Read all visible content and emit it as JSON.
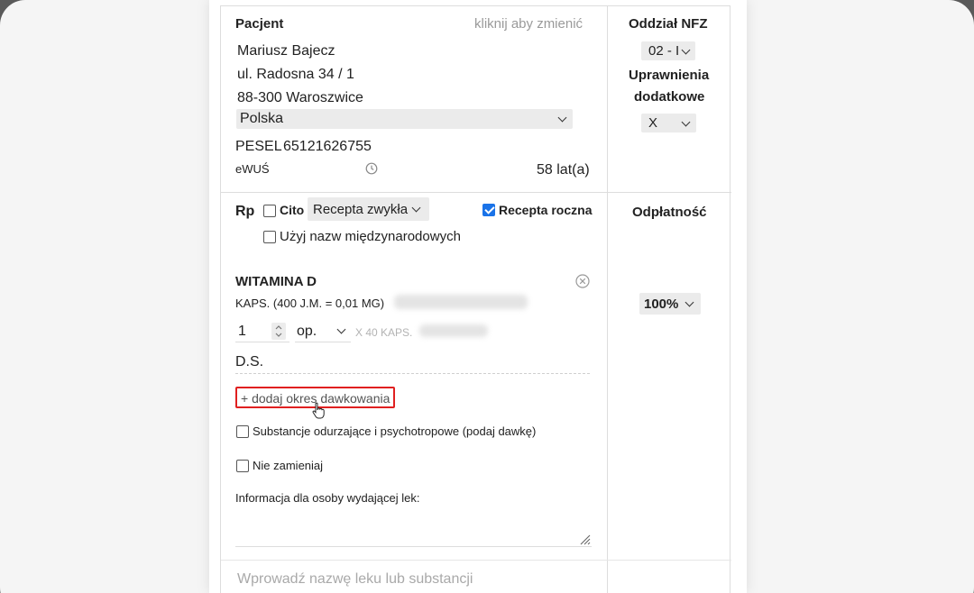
{
  "patient": {
    "heading": "Pacjent",
    "change_hint": "kliknij aby zmienić",
    "name": "Mariusz Bajecz",
    "street": "ul. Radosna 34 / 1",
    "city": "88-300 Waroszwice",
    "country": "Polska",
    "pesel_label": "PESEL",
    "pesel": "65121626755",
    "ewus_label": "eWUŚ",
    "age": "58",
    "age_unit": "lat(a)"
  },
  "nfz": {
    "heading": "Oddział NFZ",
    "branch_value": "02 - I",
    "permissions_label_1": "Uprawnienia",
    "permissions_label_2": "dodatkowe",
    "permissions_value": "X"
  },
  "prescription": {
    "rp_label": "Rp",
    "cito_label": "Cito",
    "type_value": "Recepta zwykła",
    "annual_label": "Recepta roczna",
    "annual_checked": true,
    "intl_names_label": "Użyj nazw międzynarodowych",
    "payment_heading": "Odpłatność",
    "payment_value": "100%"
  },
  "drug": {
    "name": "WITAMINA D",
    "form": "KAPS. (400 J.M. = 0,01 MG)",
    "quantity": "1",
    "unit": "op.",
    "package": "X 40 KAPS.",
    "ds_label": "D.S.",
    "add_period_button": "+ dodaj okres dawkowania",
    "narcotics_label": "Substancje odurzające i psychotropowe (podaj dawkę)",
    "no_substitute_label": "Nie zamieniaj",
    "pharmacist_info_label": "Informacja dla osoby wydającej lek:"
  },
  "search": {
    "placeholder": "Wprowadź nazwę leku lub substancji"
  }
}
